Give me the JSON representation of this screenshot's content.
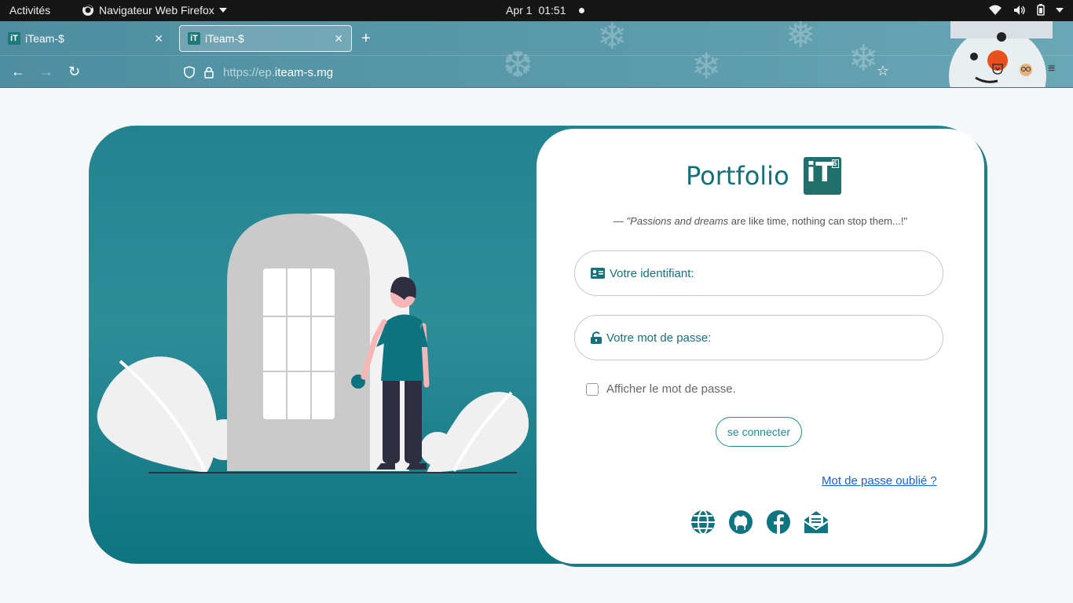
{
  "topbar": {
    "activities": "Activités",
    "app_name": "Navigateur Web Firefox",
    "date": "Apr 1",
    "time": "01:51"
  },
  "browser": {
    "tabs": [
      {
        "title": "iTeam-$",
        "favicon": "iT",
        "active": false
      },
      {
        "title": "iTeam-$",
        "favicon": "iT",
        "active": true
      }
    ],
    "url_protocol": "https://ep.",
    "url_domain": "iteam-s.mg"
  },
  "login": {
    "title": "Portfolio",
    "logo_text": "iT",
    "logo_badge": "$",
    "quote_dash": "—",
    "quote_em": "\"Passions and dreams",
    "quote_rest": " are like time, nothing can stop them...!\"",
    "username_label": "Votre identifiant:",
    "password_label": "Votre mot de passe:",
    "show_password_label": "Afficher le mot de passe.",
    "submit_label": "se connecter",
    "forgot_label": "Mot de passe oublié ?",
    "social_icons": [
      "globe-icon",
      "github-icon",
      "facebook-icon",
      "mail-icon"
    ]
  },
  "colors": {
    "accent": "#0f7580",
    "card_top": "#22838e",
    "card_bottom": "#0d747f",
    "link": "#1a5fd1"
  }
}
